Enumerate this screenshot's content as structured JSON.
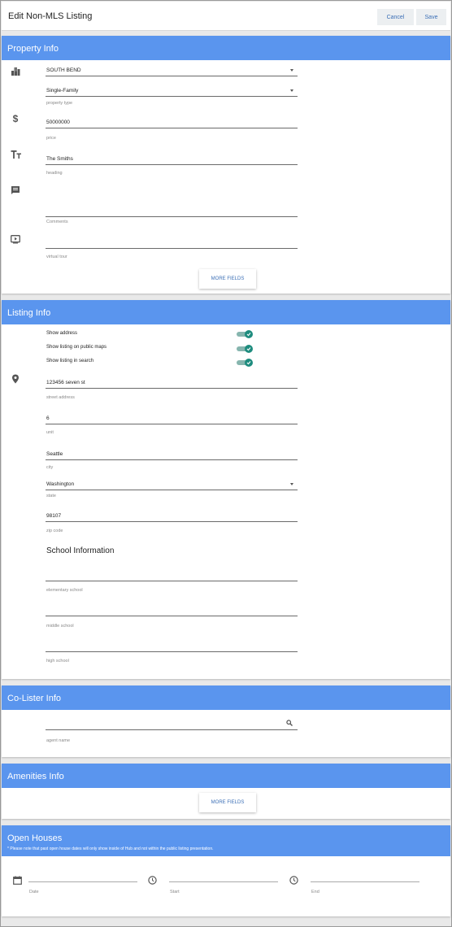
{
  "header": {
    "title": "Edit Non-MLS Listing",
    "cancel_label": "Cancel",
    "save_label": "Save"
  },
  "property": {
    "title": "Property Info",
    "area_value": "SOUTH BEND",
    "type_value": "Single-Family",
    "type_label": "property type",
    "price_value": "50000000",
    "price_label": "price",
    "heading_value": "The Smiths",
    "heading_label": "heading",
    "comments_label": "Comments",
    "tour_label": "virtual tour",
    "more_label": "MORE FIELDS"
  },
  "listing": {
    "title": "Listing Info",
    "show_address": "Show address",
    "show_maps": "Show listing on public maps",
    "show_search": "Show listing in search",
    "street_value": "123456 seven st",
    "street_label": "street address",
    "unit_value": "6",
    "unit_label": "unit",
    "city_value": "Seattle",
    "city_label": "city",
    "state_value": "Washington",
    "state_label": "state",
    "zip_value": "98107",
    "zip_label": "zip code",
    "school_title": "School Information",
    "elementary_label": "elementary school",
    "middle_label": "middle school",
    "high_label": "high school"
  },
  "colister": {
    "title": "Co-Lister Info",
    "agent_label": "agent name"
  },
  "amenities": {
    "title": "Amenities Info",
    "more_label": "MORE FIELDS"
  },
  "open_houses": {
    "title": "Open Houses",
    "notice": "* Please note that past open house dates will only show inside of Hub and not within the public listing presentation.",
    "date_label": "Date",
    "start_label": "Start",
    "end_label": "End"
  },
  "colors": {
    "header_blue": "#5a95ee",
    "toggle_on": "#1e8c7e",
    "button_text": "#3b6fb6"
  },
  "toggles": {
    "show_address": true,
    "show_maps": true,
    "show_search": true
  },
  "icons": [
    "city-icon",
    "dollar-icon",
    "text-size-icon",
    "comment-icon",
    "video-icon",
    "location-pin-icon",
    "search-icon",
    "calendar-icon",
    "clock-icon"
  ]
}
